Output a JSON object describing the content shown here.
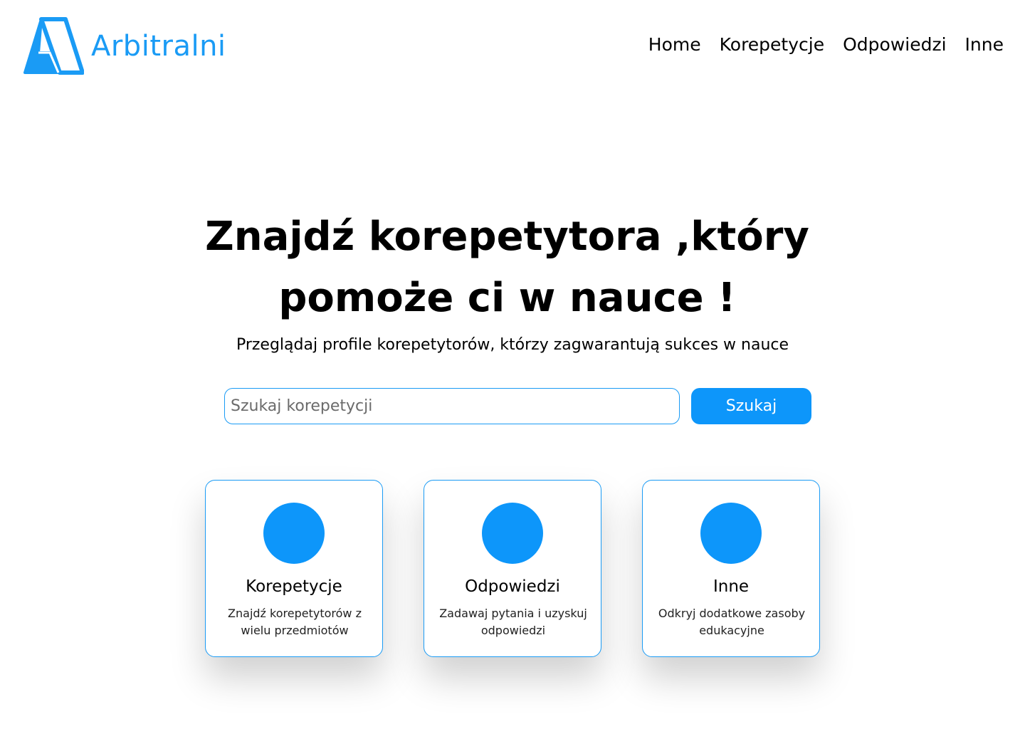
{
  "header": {
    "logo_text": "Arbitralni",
    "nav": [
      "Home",
      "Korepetycje",
      "Odpowiedzi",
      "Inne"
    ]
  },
  "hero": {
    "title_line1": "Znajdź korepetytora ,który",
    "title_line2": "pomoże ci w nauce !",
    "subtitle": "Przeglądaj profile korepetytorów, którzy zagwarantują sukces w nauce"
  },
  "search": {
    "placeholder": "Szukaj korepetycji",
    "value": "",
    "button_label": "Szukaj"
  },
  "cards": [
    {
      "title": "Korepetycje",
      "description": "Znajdź korepetytorów z wielu przedmiotów"
    },
    {
      "title": "Odpowiedzi",
      "description": "Zadawaj pytania i uzyskuj odpowiedzi"
    },
    {
      "title": "Inne",
      "description": "Odkryj dodatkowe zasoby edukacyjne"
    }
  ],
  "colors": {
    "accent": "#0d96fa",
    "logo": "#1a9bf5",
    "text": "#000000",
    "background": "#ffffff"
  }
}
